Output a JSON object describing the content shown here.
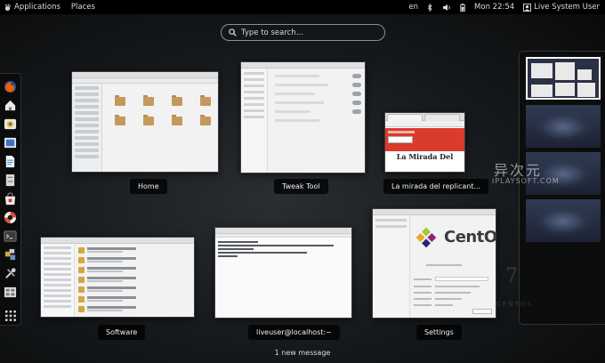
{
  "topbar": {
    "applications": "Applications",
    "places": "Places",
    "language": "en",
    "clock": "Mon 22:54",
    "user": "Live System User"
  },
  "search": {
    "placeholder": "Type to search..."
  },
  "dash": {
    "apps": [
      {
        "name": "firefox",
        "color": "#e66000"
      },
      {
        "name": "home-folder",
        "color": "#ececec"
      },
      {
        "name": "evolution",
        "color": "#f2c12e"
      },
      {
        "name": "rhythmbox",
        "color": "#3a74c7"
      },
      {
        "name": "writer",
        "color": "#2a80d2"
      },
      {
        "name": "files",
        "color": "#cfcfcf"
      },
      {
        "name": "software",
        "color": "#e8e8e8"
      },
      {
        "name": "help",
        "color": "#e04a3b"
      },
      {
        "name": "terminal",
        "color": "#3a3a3a"
      },
      {
        "name": "install",
        "color": "#d8a23c"
      },
      {
        "name": "utilities",
        "color": "#b8b8b8"
      },
      {
        "name": "screenshot",
        "color": "#9aa0a6"
      }
    ]
  },
  "windows": {
    "home": {
      "caption": "Home"
    },
    "tweak": {
      "caption": "Tweak Tool"
    },
    "firefox": {
      "caption": "La mirada del replicant...",
      "page_heading": "La Mirada Del"
    },
    "software": {
      "caption": "Software"
    },
    "terminal": {
      "caption": "liveuser@localhost:~"
    },
    "settings": {
      "caption": "Settings",
      "os_name": "CentOS"
    }
  },
  "watermark": {
    "cn": "异次元",
    "en": "IPLAYSOFT.COM",
    "version": "7",
    "os": "CENTOS"
  },
  "message": "1 new message",
  "colors": {
    "firefox_banner": "#d93b2c",
    "background": "#15181b",
    "workspace_active_border": "#ffffff"
  }
}
